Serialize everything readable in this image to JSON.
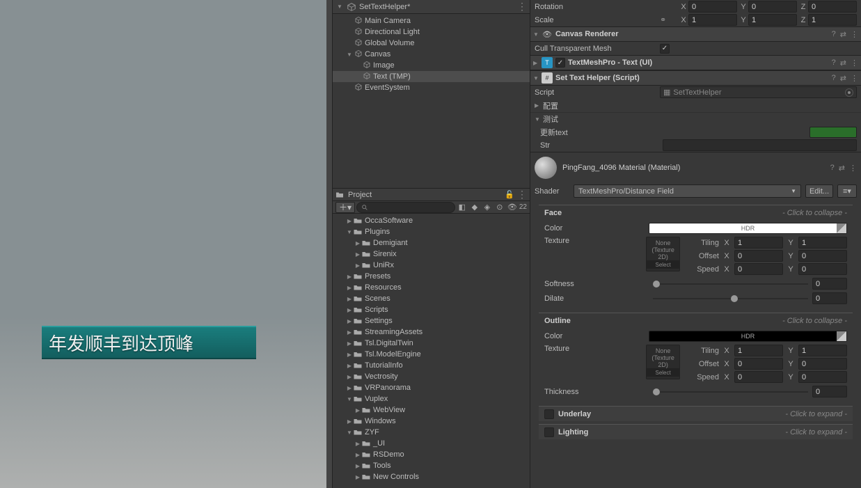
{
  "scene_text": "年发顺丰到达顶峰",
  "hierarchy": {
    "scene_name": "SetTextHelper*",
    "items": [
      {
        "name": "Main Camera",
        "indent": 1
      },
      {
        "name": "Directional Light",
        "indent": 1
      },
      {
        "name": "Global Volume",
        "indent": 1
      },
      {
        "name": "Canvas",
        "indent": 1,
        "expanded": true
      },
      {
        "name": "Image",
        "indent": 2
      },
      {
        "name": "Text (TMP)",
        "indent": 2,
        "selected": true
      },
      {
        "name": "EventSystem",
        "indent": 1
      }
    ]
  },
  "project": {
    "title": "Project",
    "hidden_count": "22",
    "items": [
      {
        "name": "OccaSoftware",
        "indent": 1
      },
      {
        "name": "Plugins",
        "indent": 1,
        "expanded": true
      },
      {
        "name": "Demigiant",
        "indent": 2
      },
      {
        "name": "Sirenix",
        "indent": 2
      },
      {
        "name": "UniRx",
        "indent": 2
      },
      {
        "name": "Presets",
        "indent": 1
      },
      {
        "name": "Resources",
        "indent": 1
      },
      {
        "name": "Scenes",
        "indent": 1
      },
      {
        "name": "Scripts",
        "indent": 1
      },
      {
        "name": "Settings",
        "indent": 1
      },
      {
        "name": "StreamingAssets",
        "indent": 1
      },
      {
        "name": "Tsl.DigitalTwin",
        "indent": 1
      },
      {
        "name": "Tsl.ModelEngine",
        "indent": 1
      },
      {
        "name": "TutorialInfo",
        "indent": 1
      },
      {
        "name": "Vectrosity",
        "indent": 1
      },
      {
        "name": "VRPanorama",
        "indent": 1
      },
      {
        "name": "Vuplex",
        "indent": 1,
        "expanded": true
      },
      {
        "name": "WebView",
        "indent": 2
      },
      {
        "name": "Windows",
        "indent": 1
      },
      {
        "name": "ZYF",
        "indent": 1,
        "expanded": true
      },
      {
        "name": "_UI",
        "indent": 2
      },
      {
        "name": "RSDemo",
        "indent": 2
      },
      {
        "name": "Tools",
        "indent": 2
      },
      {
        "name": "New Controls",
        "indent": 2,
        "special": true
      }
    ]
  },
  "inspector": {
    "rotation_label": "Rotation",
    "scale_label": "Scale",
    "rotation": {
      "x": "0",
      "y": "0",
      "z": "0"
    },
    "scale": {
      "x": "1",
      "y": "1",
      "z": "1"
    },
    "canvas_renderer": {
      "title": "Canvas Renderer",
      "cull_label": "Cull Transparent Mesh",
      "cull": true
    },
    "tmp": {
      "title": "TextMeshPro - Text (UI)"
    },
    "script_comp": {
      "title": "Set Text Helper (Script)",
      "script_label": "Script",
      "script_value": "SetTextHelper",
      "foldouts": [
        "配置",
        "测试"
      ],
      "update_label": "更新text",
      "str_label": "Str"
    },
    "material": {
      "title": "PingFang_4096 Material (Material)",
      "shader_label": "Shader",
      "shader_value": "TextMeshPro/Distance Field",
      "edit_label": "Edit...",
      "face": {
        "title": "Face",
        "color_label": "Color",
        "texture_label": "Texture",
        "none_label": "None (Texture 2D)",
        "select_label": "Select",
        "tiling_label": "Tiling",
        "offset_label": "Offset",
        "speed_label": "Speed",
        "tiling": {
          "x": "1",
          "y": "1"
        },
        "offset": {
          "x": "0",
          "y": "0"
        },
        "speed": {
          "x": "0",
          "y": "0"
        },
        "softness_label": "Softness",
        "softness": "0",
        "dilate_label": "Dilate",
        "dilate": "0",
        "collapse_hint": "- Click to collapse -"
      },
      "outline": {
        "title": "Outline",
        "color_label": "Color",
        "texture_label": "Texture",
        "none_label": "None (Texture 2D)",
        "select_label": "Select",
        "tiling_label": "Tiling",
        "offset_label": "Offset",
        "speed_label": "Speed",
        "tiling": {
          "x": "1",
          "y": "1"
        },
        "offset": {
          "x": "0",
          "y": "0"
        },
        "speed": {
          "x": "0",
          "y": "0"
        },
        "thickness_label": "Thickness",
        "thickness": "0",
        "collapse_hint": "- Click to collapse -"
      },
      "underlay": {
        "title": "Underlay",
        "hint": "- Click to expand -"
      },
      "lighting": {
        "title": "Lighting",
        "hint": "- Click to expand -"
      },
      "hdr_label": "HDR"
    }
  }
}
